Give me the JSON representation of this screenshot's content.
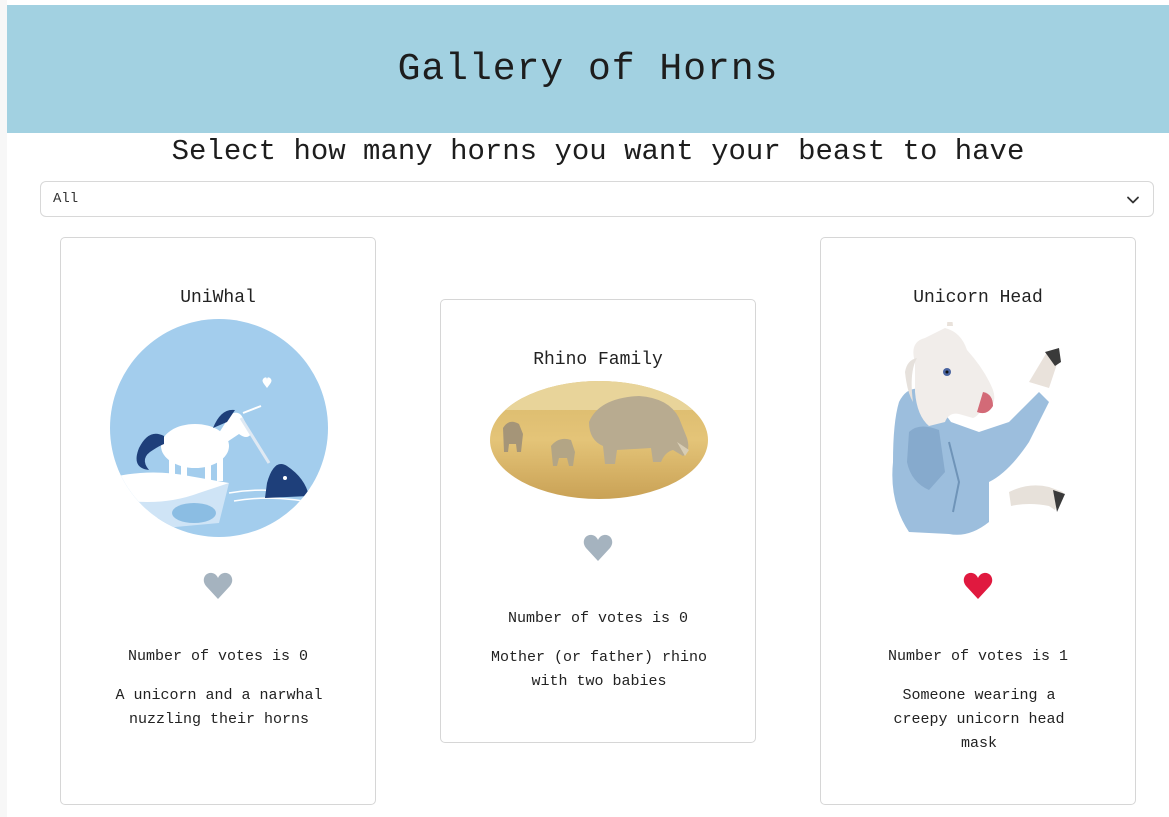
{
  "header": {
    "title": "Gallery of Horns"
  },
  "filter": {
    "prompt": "Select how many horns you want your beast to have",
    "selected": "All"
  },
  "colors": {
    "header_bg": "#a2d1e1",
    "heart_inactive": "#a5b3bf",
    "heart_active": "#e0193f"
  },
  "cards": [
    {
      "title": "UniWhal",
      "image": "unicorn-narwhal-illustration",
      "liked": false,
      "votes": "Number of votes is 0",
      "description": "A unicorn and a narwhal nuzzling their horns"
    },
    {
      "title": "Rhino Family",
      "image": "rhino-family-photo",
      "liked": false,
      "votes": "Number of votes is 0",
      "description": "Mother (or father) rhino with two babies"
    },
    {
      "title": "Unicorn Head",
      "image": "unicorn-mask-photo",
      "liked": true,
      "votes": "Number of votes is 1",
      "description": "Someone wearing a creepy unicorn head mask"
    }
  ]
}
